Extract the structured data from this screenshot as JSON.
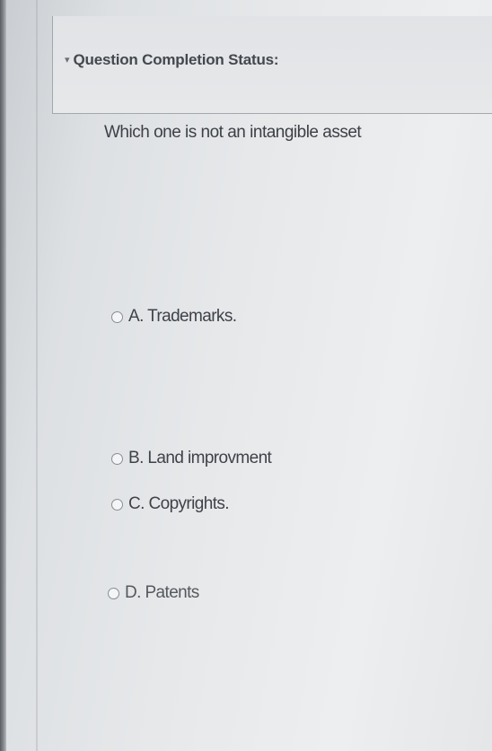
{
  "header": {
    "expand_icon": "▾",
    "status_label": "Question Completion Status:"
  },
  "question": {
    "text": "Which one is not an intangible asset"
  },
  "options": [
    {
      "text": "A. Trademarks."
    },
    {
      "text": "B. Land improvment"
    },
    {
      "text": "C. Copyrights."
    },
    {
      "text": "D. Patents"
    }
  ]
}
